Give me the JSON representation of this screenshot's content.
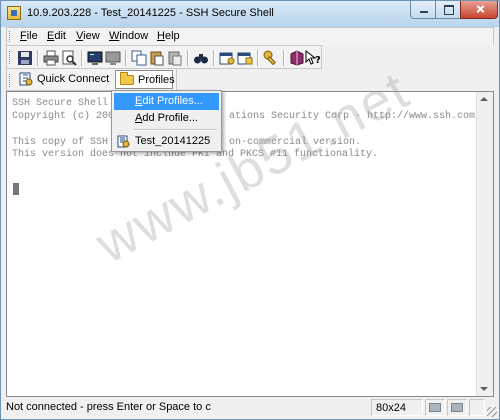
{
  "window": {
    "title": "10.9.203.228 - Test_20141225 - SSH Secure Shell"
  },
  "menu": {
    "file": {
      "key": "F",
      "rest": "ile"
    },
    "edit": {
      "key": "E",
      "rest": "dit"
    },
    "view": {
      "key": "V",
      "rest": "iew"
    },
    "window": {
      "key": "W",
      "rest": "indow"
    },
    "help": {
      "key": "H",
      "rest": "elp"
    }
  },
  "toolbar": {
    "icons": [
      "save-icon",
      "print-icon",
      "print-preview-icon",
      "new-terminal-icon",
      "new-file-transfer-icon",
      "copy-icon",
      "paste-icon",
      "paste-alt-icon",
      "find-icon",
      "settings-icon",
      "profile-settings-icon",
      "key-icon",
      "help-book-icon",
      "context-help-icon"
    ]
  },
  "profile_bar": {
    "quick_connect": "Quick Connect",
    "profiles": "Profiles"
  },
  "dropdown": {
    "edit_profiles": {
      "key": "E",
      "rest": "dit Profiles..."
    },
    "add_profile": {
      "key": "A",
      "rest": "dd Profile..."
    },
    "profile_entry": "Test_20141225"
  },
  "terminal": {
    "line1": "SSH Secure Shell",
    "line2_left": "Copyright (c) 200",
    "line2_right": "ations Security Corp - http://www.ssh.com/",
    "line3_left": "This copy of SSH",
    "line3_right": "on-commercial version.",
    "line4": "This version does not include PKI and PKCS #11 functionality."
  },
  "watermark": "www.jb51.net",
  "status": {
    "message": "Not connected - press Enter or Space to conne",
    "size": "80x24"
  },
  "colors": {
    "highlight": "#3399ff",
    "close_button": "#c74530"
  }
}
